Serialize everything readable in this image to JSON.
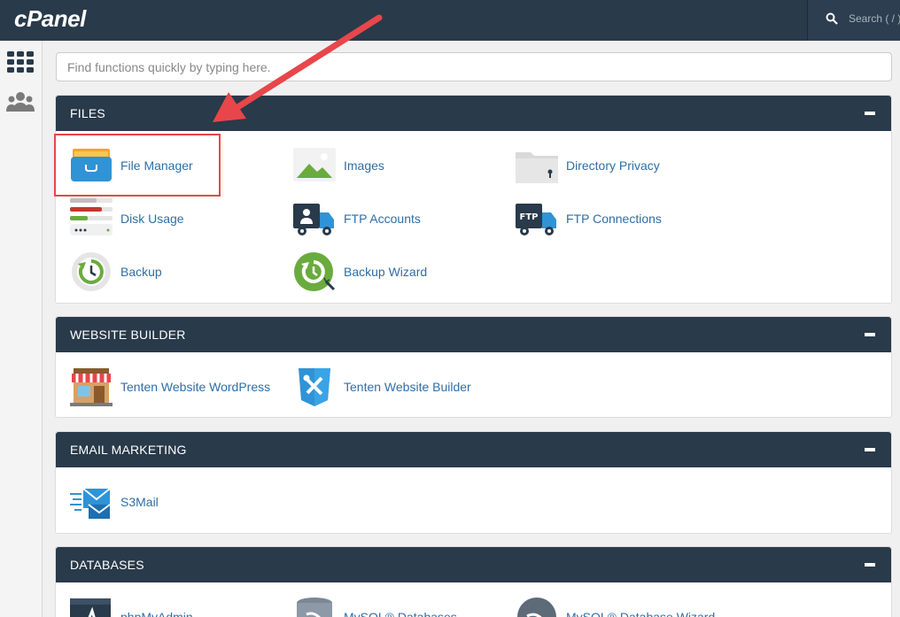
{
  "header": {
    "logo": "cPanel",
    "search_placeholder": "Search ( / )"
  },
  "sidebar": {
    "items": [
      {
        "icon": "grid-icon"
      },
      {
        "icon": "users-icon"
      }
    ]
  },
  "quick_search": {
    "placeholder": "Find functions quickly by typing here."
  },
  "sections": {
    "files": {
      "title": "FILES",
      "items": [
        {
          "label": "File Manager",
          "icon": "file-manager-icon"
        },
        {
          "label": "Images",
          "icon": "images-icon"
        },
        {
          "label": "Directory Privacy",
          "icon": "directory-privacy-icon"
        },
        {
          "label": "Disk Usage",
          "icon": "disk-usage-icon"
        },
        {
          "label": "FTP Accounts",
          "icon": "ftp-accounts-icon"
        },
        {
          "label": "FTP Connections",
          "icon": "ftp-connections-icon"
        },
        {
          "label": "Backup",
          "icon": "backup-icon"
        },
        {
          "label": "Backup Wizard",
          "icon": "backup-wizard-icon"
        }
      ]
    },
    "website_builder": {
      "title": "WEBSITE BUILDER",
      "items": [
        {
          "label": "Tenten Website WordPress",
          "icon": "storefront-icon"
        },
        {
          "label": "Tenten Website Builder",
          "icon": "tools-shield-icon"
        }
      ]
    },
    "email_marketing": {
      "title": "EMAIL MARKETING",
      "items": [
        {
          "label": "S3Mail",
          "icon": "mail-icon"
        }
      ]
    },
    "databases": {
      "title": "DATABASES",
      "items": [
        {
          "label": "phpMyAdmin",
          "icon": "phpmyadmin-icon"
        },
        {
          "label": "MySQL® Databases",
          "icon": "mysql-databases-icon"
        },
        {
          "label": "MySQL® Database Wizard",
          "icon": "mysql-wizard-icon"
        }
      ]
    }
  },
  "colors": {
    "header_bg": "#293a4a",
    "link": "#2f6ea6",
    "annotation": "#e8464a"
  }
}
